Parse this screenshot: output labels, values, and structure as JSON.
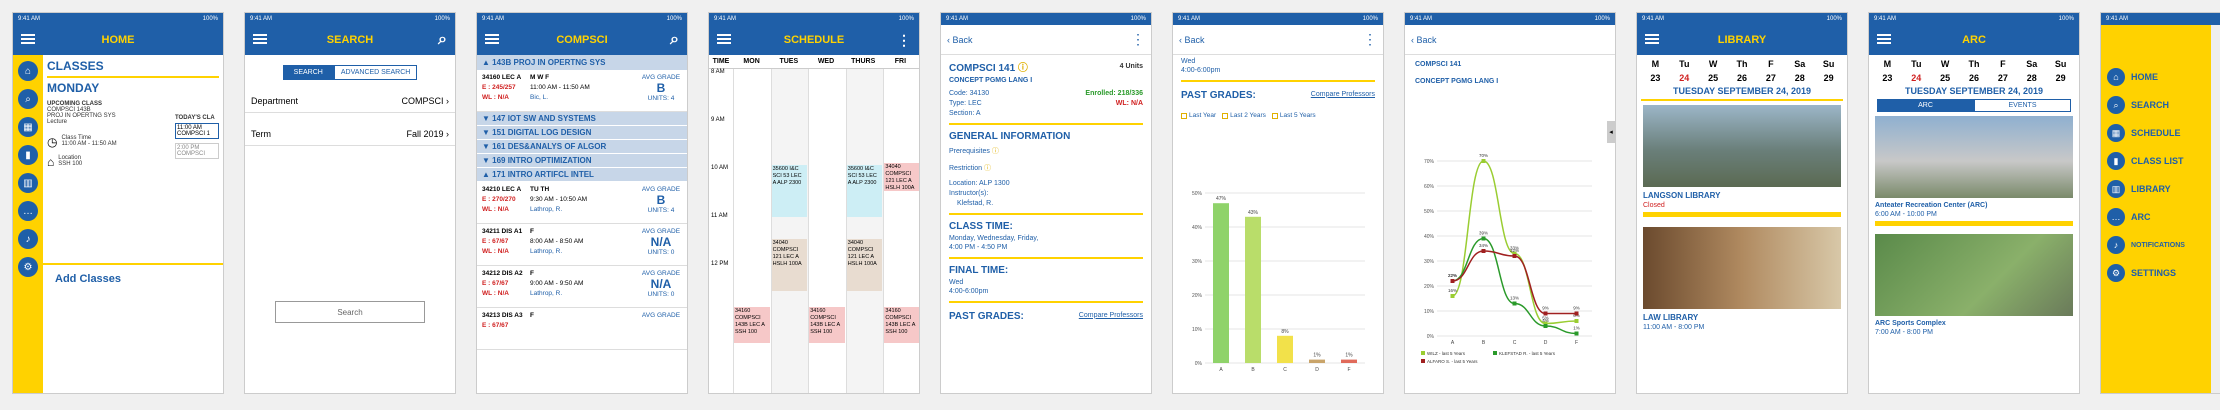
{
  "status": {
    "time": "9:41 AM",
    "battery": "100%"
  },
  "home": {
    "title": "HOME",
    "section": "CLASSES",
    "day": "MONDAY",
    "upcoming_label": "UPCOMING CLASS",
    "upcoming_course": "COMPSCI 143B",
    "upcoming_name": "PROJ IN OPERTNG SYS",
    "upcoming_type": "Lecture",
    "todays_label": "TODAY'S CLA",
    "todays_time1": "11:00 AM",
    "todays_course1": "COMPSCI 1",
    "todays_time2": "2:00 PM",
    "todays_course2": "COMPSCI",
    "class_time_label": "Class Time",
    "class_time": "11:00 AM - 11:50 AM",
    "location_label": "Location",
    "location": "SSH 100",
    "add_classes": "Add Classes"
  },
  "search": {
    "title": "SEARCH",
    "tab_search": "SEARCH",
    "tab_advanced": "ADVANCED SEARCH",
    "department_label": "Department",
    "department_value": "COMPSCI",
    "term_label": "Term",
    "term_value": "Fall 2019",
    "button": "Search"
  },
  "compsci": {
    "title": "COMPSCI",
    "group1": "143B PROJ IN OPERTNG SYS",
    "rows": [
      {
        "code": "34160 LEC A",
        "enrl": "E : 245/257",
        "wl": "WL : N/A",
        "days": "M W F",
        "time": "11:00 AM - 11:50 AM",
        "instr": "Bic, L.",
        "grade_label": "AVG GRADE",
        "grade": "B",
        "units": "UNITS: 4"
      }
    ],
    "groups": [
      "147 IOT SW AND SYSTEMS",
      "151 DIGITAL LOG DESIGN",
      "161 DES&ANALYS OF ALGOR",
      "169 INTRO OPTIMIZATION",
      "171 INTRO ARTIFCL INTEL"
    ],
    "rows2": [
      {
        "code": "34210 LEC A",
        "enrl": "E : 270/270",
        "wl": "WL : N/A",
        "days": "TU TH",
        "time": "9:30 AM - 10:50 AM",
        "instr": "Lathrop, R.",
        "grade_label": "AVG GRADE",
        "grade": "B",
        "units": "UNITS: 4"
      },
      {
        "code": "34211 DIS A1",
        "enrl": "E : 67/67",
        "wl": "WL : N/A",
        "days": "F",
        "time": "8:00 AM - 8:50 AM",
        "instr": "Lathrop, R.",
        "grade_label": "AVG GRADE",
        "grade": "N/A",
        "units": "UNITS: 0"
      },
      {
        "code": "34212 DIS A2",
        "enrl": "E : 67/67",
        "wl": "WL : N/A",
        "days": "F",
        "time": "9:00 AM - 9:50 AM",
        "instr": "Lathrop, R.",
        "grade_label": "AVG GRADE",
        "grade": "N/A",
        "units": "UNITS: 0"
      },
      {
        "code": "34213 DIS A3",
        "enrl": "E : 67/67",
        "wl": "",
        "days": "F",
        "time": "",
        "instr": "",
        "grade_label": "AVG GRADE",
        "grade": "",
        "units": ""
      }
    ]
  },
  "schedule": {
    "title": "SCHEDULE",
    "days": [
      "TIME",
      "MON",
      "TUES",
      "WED",
      "THURS",
      "FRI"
    ],
    "times": [
      "8 AM",
      "9 AM",
      "10 AM",
      "11 AM",
      "12 PM"
    ],
    "block_a": "35600 I&C SCI 53 LEC A ALP 2300",
    "block_b": "34040 COMPSCI 121 LEC A HSLH 100A",
    "block_c": "34160 COMPSCI 143B LEC A SSH 100"
  },
  "detail": {
    "back": "Back",
    "course": "COMPSCI 141",
    "units": "4 Units",
    "name": "CONCEPT PGMG LANG I",
    "code": "Code: 34130",
    "enrolled": "Enrolled: 218/336",
    "type": "Type: LEC",
    "wl": "WL: N/A",
    "section": "Section: A",
    "gen_info": "GENERAL INFORMATION",
    "prereq": "Prerequisites",
    "restriction": "Restriction",
    "location": "Location: ALP 1300",
    "instructor_label": "Instructor(s):",
    "instructor": "Klefstad, R.",
    "class_time_label": "CLASS TIME:",
    "class_days": "Monday, Wednesday, Friday,",
    "class_time": "4:00 PM - 4:50 PM",
    "final_label": "FINAL TIME:",
    "final_day": "Wed",
    "final_time": "4:00-6:00pm",
    "past_label": "PAST GRADES:",
    "compare": "Compare Professors"
  },
  "grades": {
    "back": "Back",
    "wed": "Wed",
    "time": "4:00-6:00pm",
    "past_label": "PAST GRADES:",
    "compare": "Compare Professors",
    "opts": [
      "Last Year",
      "Last 2 Years",
      "Last 5 Years"
    ]
  },
  "chart_data": [
    {
      "type": "bar",
      "categories": [
        "A",
        "B",
        "C",
        "D",
        "F"
      ],
      "values": [
        47,
        43,
        8,
        1,
        1
      ],
      "value_labels": [
        "47%",
        "43%",
        "8%",
        "1%",
        "1%"
      ],
      "colors": [
        "#8fd36a",
        "#b9dd6a",
        "#f2e14a",
        "#c9a46a",
        "#e06a5a"
      ],
      "ylim": [
        0,
        50
      ]
    },
    {
      "type": "line",
      "categories": [
        "A",
        "B",
        "C",
        "D",
        "F"
      ],
      "series": [
        {
          "name": "WILZ - last 5 Years",
          "color": "#9acd32",
          "values": [
            16,
            70,
            33,
            5,
            6
          ]
        },
        {
          "name": "KLEFSTAD R. - last 5 Years",
          "color": "#2a9a2a",
          "values": [
            22,
            39,
            13,
            4,
            1
          ]
        },
        {
          "name": "ALFARO S. - last 5 Years",
          "color": "#a02020",
          "values": [
            22,
            34,
            32,
            9,
            9
          ]
        }
      ],
      "point_labels": [
        [
          "16%",
          "70%",
          "33%",
          "5%",
          "6%"
        ],
        [
          "22%",
          "39%",
          "13%",
          "4%",
          "1%"
        ],
        [
          "22%",
          "34%",
          "32%",
          "9%",
          "9%"
        ]
      ],
      "ylim": [
        0,
        70
      ],
      "yticks": [
        "0%",
        "10%",
        "20%",
        "30%",
        "40%",
        "50%",
        "60%",
        "70%"
      ]
    }
  ],
  "compare": {
    "back": "Back",
    "course": "COMPSCI 141",
    "name": "CONCEPT PGMG LANG I",
    "legend": [
      "WILZ - last 5 Years",
      "KLEFSTAD R. - last 5 Years",
      "ALFARO S. - last 5 Years"
    ]
  },
  "library": {
    "title": "LIBRARY",
    "weekdays": [
      "M",
      "Tu",
      "W",
      "Th",
      "F",
      "Sa",
      "Su"
    ],
    "dates": [
      "23",
      "24",
      "25",
      "26",
      "27",
      "28",
      "29"
    ],
    "date_long": "TUESDAY SEPTEMBER 24, 2019",
    "lib1": "LANGSON LIBRARY",
    "lib1_status": "Closed",
    "lib2": "LAW LIBRARY",
    "lib2_hours": "11:00 AM - 8:00 PM"
  },
  "arc": {
    "title": "ARC",
    "tab_arc": "ARC",
    "tab_events": "EVENTS",
    "place1": "Anteater Recreation Center (ARC)",
    "place1_hours": "6:00 AM - 10:00 PM",
    "place2": "ARC Sports Complex",
    "place2_hours": "7:00 AM - 8:00 PM"
  },
  "menu": {
    "items": [
      "HOME",
      "SEARCH",
      "SCHEDULE",
      "CLASS LIST",
      "LIBRARY",
      "ARC",
      "NOTIFICATIONS",
      "SETTINGS"
    ]
  }
}
